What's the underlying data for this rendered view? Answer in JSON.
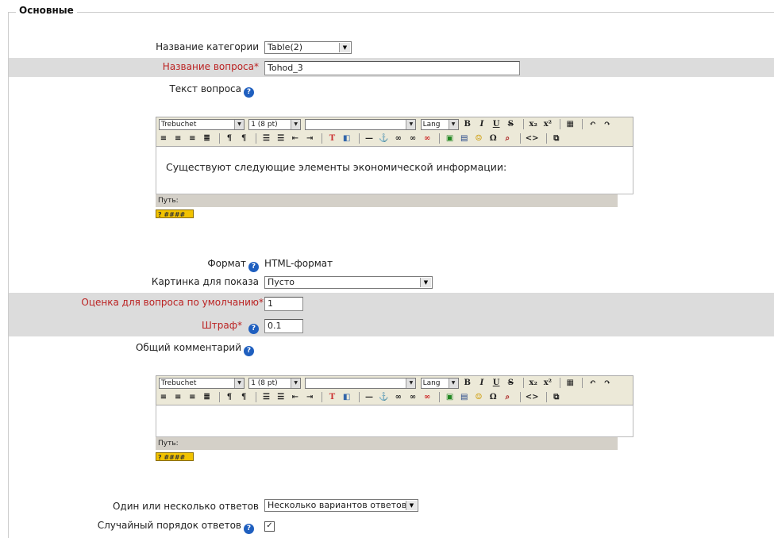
{
  "fieldset": {
    "legend": "Основные"
  },
  "category": {
    "label": "Название категории",
    "value": "Table(2)"
  },
  "question_name": {
    "label": "Название вопроса",
    "star": "*",
    "value": "Tohod_3"
  },
  "question_text": {
    "label": "Текст вопроса"
  },
  "editor1": {
    "font": "Trebuchet",
    "size": "1 (8 pt)",
    "style": "",
    "lang": "Lang",
    "content": "Существуют следующие элементы экономической информации:",
    "path_label": "Путь:"
  },
  "format": {
    "label": "Формат",
    "value": "HTML-формат"
  },
  "image": {
    "label": "Картинка для показа",
    "value": "Пусто"
  },
  "default_grade": {
    "label": "Оценка для вопроса по умолчанию",
    "star": "*",
    "value": "1"
  },
  "penalty": {
    "label": "Штраф",
    "star": "*",
    "value": "0.1"
  },
  "general_feedback": {
    "label": "Общий комментарий"
  },
  "editor2": {
    "font": "Trebuchet",
    "size": "1 (8 pt)",
    "style": "",
    "lang": "Lang",
    "content": "",
    "path_label": "Путь:"
  },
  "single": {
    "label": "Один или несколько ответов",
    "value": "Несколько вариантов ответов"
  },
  "shuffle": {
    "label": "Случайный порядок ответов",
    "checked": "✓"
  },
  "colors": {
    "required": "#b22222",
    "band": "#dcdcdc",
    "help": "#1f5fbf"
  }
}
